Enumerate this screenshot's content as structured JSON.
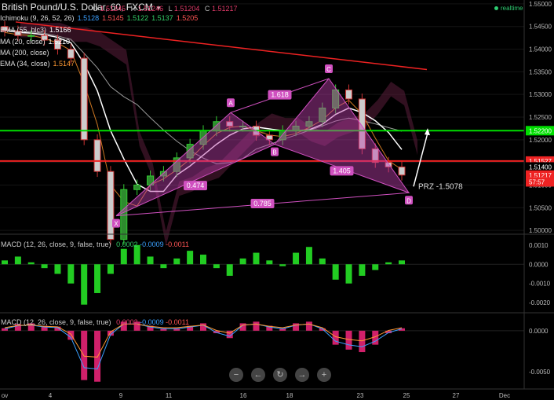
{
  "header": {
    "title": "British Pound/U.S. Dollar, 60, FXCM",
    "ohlc": [
      {
        "key": "O",
        "value": "1.51245"
      },
      {
        "key": "H",
        "value": "1.51246"
      },
      {
        "key": "L",
        "value": "1.51204"
      },
      {
        "key": "C",
        "value": "1.51217"
      }
    ],
    "realtime": "realtime"
  },
  "indicators": [
    {
      "label": "Ichimoku (9, 26, 52, 26)",
      "values": [
        "1.5128",
        "1.5145",
        "1.5122",
        "1.5137",
        "1.5205"
      ],
      "colors": [
        "#3aa0ff",
        "#ff5555",
        "#33cc66",
        "#33cc66",
        "#ff5555"
      ]
    },
    {
      "label": "EMA (55, hlc3)",
      "values": [
        "1.5166"
      ],
      "colors": [
        "#ffffff"
      ]
    },
    {
      "label": "MA (20, close)",
      "values": [
        "1.5210"
      ],
      "colors": [
        "#ffffff"
      ]
    },
    {
      "label": "MA (200, close)",
      "values": [],
      "colors": []
    },
    {
      "label": "EMA (34, close)",
      "values": [
        "1.5147"
      ],
      "colors": [
        "#ff9933"
      ]
    }
  ],
  "price_axis": {
    "ticks": [
      "1.55000",
      "1.54500",
      "1.54000",
      "1.53500",
      "1.53000",
      "1.52500",
      "1.52000",
      "1.51500",
      "1.51000",
      "1.50500",
      "1.50000"
    ],
    "badges": [
      {
        "text": "1.52200",
        "color": "#00dd00",
        "price": 1.522
      },
      {
        "text": "1.51527",
        "color": "#ee2222",
        "price": 1.5153
      },
      {
        "text": "1.51400",
        "color": "#000000",
        "price": 1.514
      },
      {
        "text": "1.51217",
        "color": "#ee2222",
        "price": 1.5122
      },
      {
        "text": "57:57",
        "color": "#ee2222",
        "price": 1.5107
      }
    ]
  },
  "x_axis": {
    "ticks": [
      "ov",
      "4",
      "9",
      "11",
      "16",
      "18",
      "23",
      "25",
      "27",
      "Dec"
    ]
  },
  "pattern": {
    "points": {
      "X": 1.5032,
      "A": 1.526,
      "B": 1.519,
      "C": 1.5335,
      "D": 1.5083
    },
    "labels": [
      "X",
      "A",
      "B",
      "C",
      "D"
    ],
    "ratios": [
      "1.618",
      "0.474",
      "1.405",
      "0.785"
    ],
    "prz": "PRZ -1.5078"
  },
  "macd1": {
    "label": "MACD (12, 26, close, 9, false, true)",
    "values": [
      "0.0002",
      "-0.0009",
      "-0.0011"
    ],
    "value_colors": [
      "#33cc66",
      "#3aa0ff",
      "#ff5555"
    ],
    "ticks": [
      "0.0010",
      "0.0000",
      "-0.0010",
      "-0.0020"
    ]
  },
  "macd2": {
    "label": "MACD (12, 26, close, 9, false, true)",
    "values": [
      "0.0002",
      "-0.0009",
      "-0.0011"
    ],
    "value_colors": [
      "#e23b6a",
      "#3aa0ff",
      "#ff5555"
    ],
    "ticks": [
      "0.0000",
      "-0.0050"
    ]
  },
  "nav_buttons": [
    "−",
    "←",
    "↻",
    "→",
    "+"
  ],
  "chart_data": {
    "type": "candlestick",
    "instrument": "British Pound/U.S. Dollar",
    "timeframe": "60",
    "ylim": [
      1.4995,
      1.5505
    ],
    "close": [
      1.544,
      1.543,
      1.543,
      1.542,
      1.54,
      1.538,
      1.52,
      1.513,
      1.498,
      1.509,
      1.51,
      1.512,
      1.513,
      1.516,
      1.519,
      1.522,
      1.524,
      1.523,
      1.523,
      1.521,
      1.52,
      1.522,
      1.523,
      1.524,
      1.527,
      1.531,
      1.529,
      1.518,
      1.515,
      1.514,
      1.5122
    ],
    "horizontal_lines": [
      {
        "price": 1.522,
        "color": "#00dd00"
      },
      {
        "price": 1.5153,
        "color": "#ee2222"
      }
    ],
    "resistance_line": {
      "from": 1.546,
      "to": 1.5355
    },
    "macd_histogram": [
      0.0002,
      0.0004,
      0.0001,
      -0.0002,
      -0.0005,
      -0.001,
      -0.0021,
      -0.0015,
      -0.0005,
      0.0008,
      0.001,
      0.0004,
      -0.0002,
      0.0003,
      0.0007,
      0.0005,
      -0.0002,
      -0.0006,
      0.0003,
      0.0006,
      0.0002,
      -0.0001,
      0.0006,
      0.0009,
      0.0003,
      -0.0008,
      -0.001,
      -0.0006,
      -0.0003,
      0.0001,
      0.0002
    ],
    "macd2_histogram": [
      0.0003,
      0.0008,
      0.0009,
      0.0006,
      0.0005,
      -0.0011,
      -0.006,
      -0.0062,
      -0.0006,
      0.0011,
      0.0011,
      0.0006,
      0.0003,
      0.0003,
      0.0006,
      0.0009,
      -0.0003,
      -0.0009,
      0.0009,
      0.0011,
      0.0006,
      0.0003,
      0.0009,
      0.0011,
      0.0003,
      -0.0017,
      -0.0023,
      -0.0026,
      -0.0017,
      -0.0003,
      0.0003
    ]
  }
}
